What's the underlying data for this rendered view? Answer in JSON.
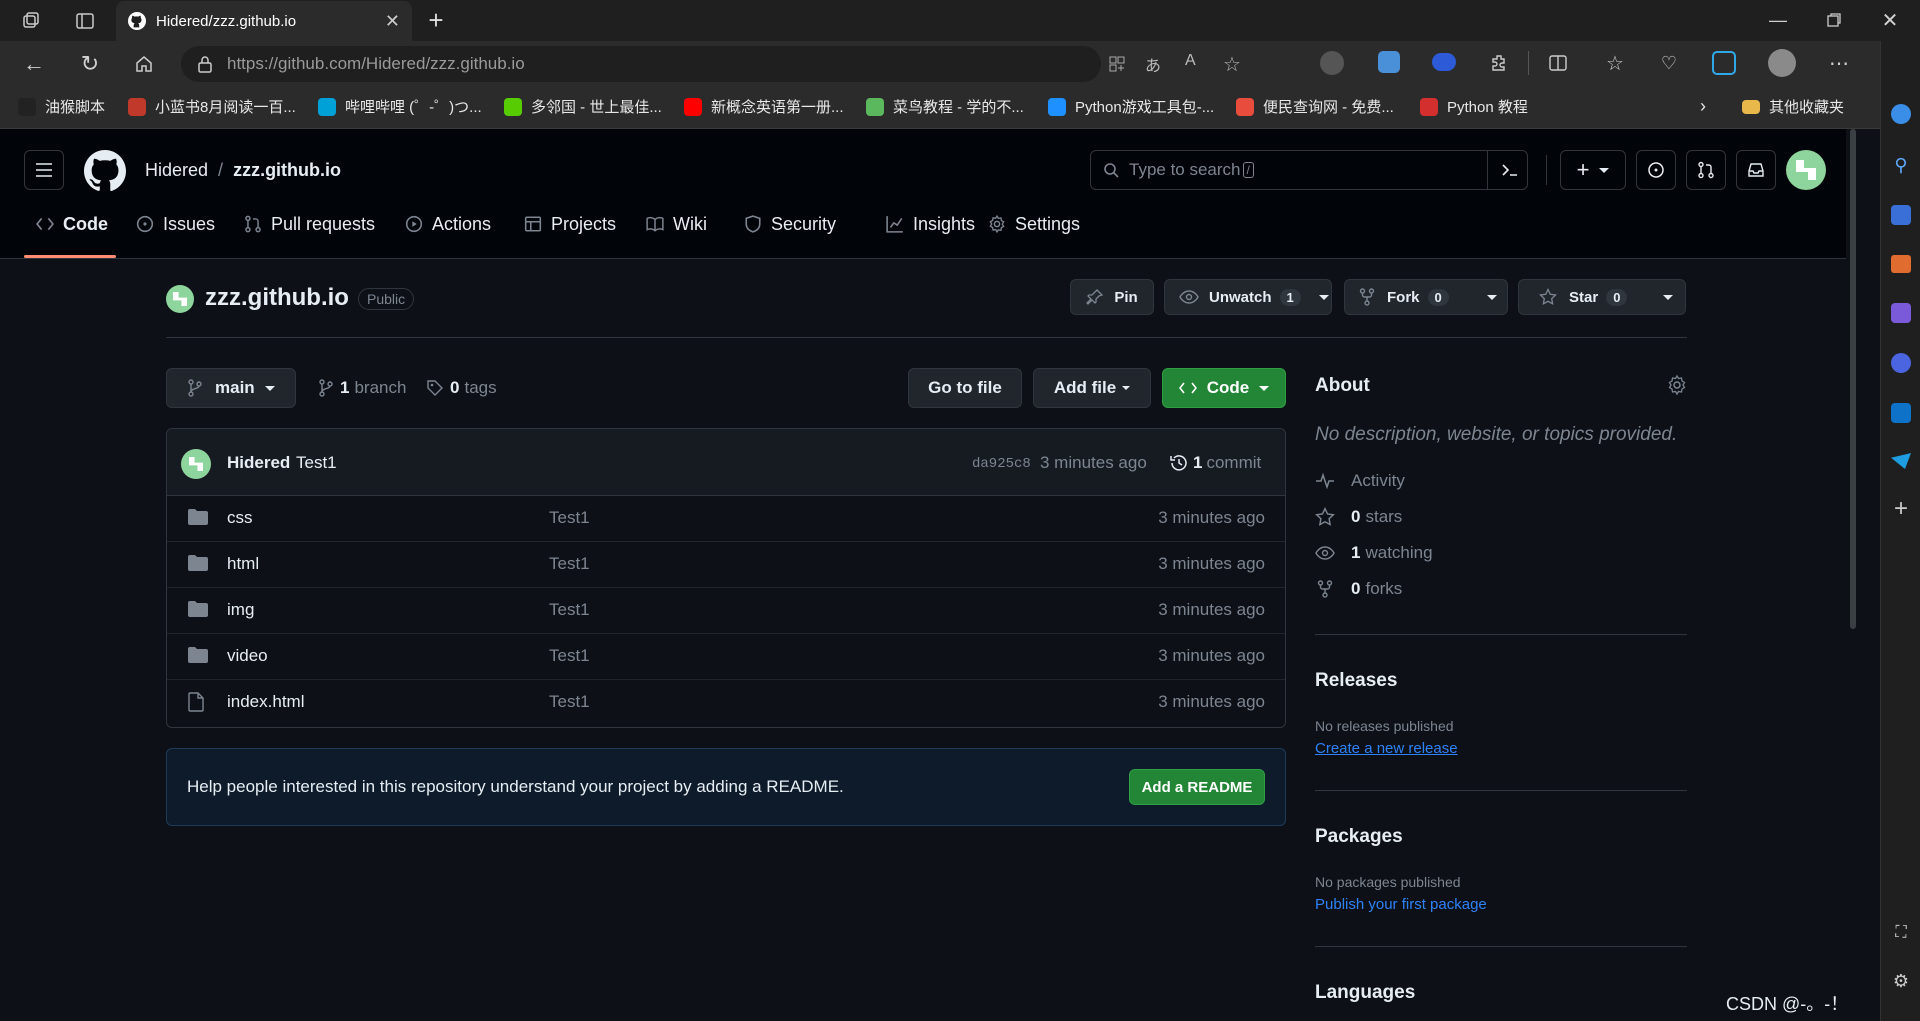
{
  "browser": {
    "tab_title": "Hidered/zzz.github.io",
    "url_host": "https://github.com",
    "url_path": "/Hidered/zzz.github.io",
    "bookmarks": [
      {
        "label": "油猴脚本",
        "color": "#222222"
      },
      {
        "label": "小蓝书8月阅读一百...",
        "color": "#c0392b"
      },
      {
        "label": "哔哩哔哩 (゜-゜)つ...",
        "color": "#00a1d6"
      },
      {
        "label": "多邻国 - 世上最佳...",
        "color": "#58cc02"
      },
      {
        "label": "新概念英语第一册...",
        "color": "#ff0000"
      },
      {
        "label": "菜鸟教程 - 学的不...",
        "color": "#5cb85c"
      },
      {
        "label": "Python游戏工具包-...",
        "color": "#1e90ff"
      },
      {
        "label": "便民查询网 - 免费...",
        "color": "#e74c3c"
      },
      {
        "label": "Python 教程",
        "color": "#d32f2f"
      }
    ],
    "other_bookmarks": "其他收藏夹"
  },
  "header": {
    "owner": "Hidered",
    "separator": "/",
    "repo": "zzz.github.io",
    "search_placeholder": "Type to search",
    "search_key": "/"
  },
  "nav": {
    "tabs": [
      {
        "label": "Code",
        "icon": "code-icon"
      },
      {
        "label": "Issues",
        "icon": "issue-icon"
      },
      {
        "label": "Pull requests",
        "icon": "pull-request-icon"
      },
      {
        "label": "Actions",
        "icon": "play-icon"
      },
      {
        "label": "Projects",
        "icon": "table-icon"
      },
      {
        "label": "Wiki",
        "icon": "book-icon"
      },
      {
        "label": "Security",
        "icon": "shield-icon"
      },
      {
        "label": "Insights",
        "icon": "graph-icon"
      },
      {
        "label": "Settings",
        "icon": "gear-icon"
      }
    ],
    "accent": "#fd8c73"
  },
  "repo": {
    "name": "zzz.github.io",
    "visibility": "Public",
    "pin": "Pin",
    "unwatch": "Unwatch",
    "unwatch_count": "1",
    "fork": "Fork",
    "fork_count": "0",
    "star": "Star",
    "star_count": "0"
  },
  "toolbar": {
    "branch": "main",
    "branch_count": "1",
    "branch_label": "branch",
    "tag_count": "0",
    "tag_label": "tags",
    "go_to_file": "Go to file",
    "add_file": "Add file",
    "code": "Code",
    "code_color": "#238636"
  },
  "commit": {
    "author": "Hidered",
    "message": "Test1",
    "sha": "da925c8",
    "time": "3 minutes ago",
    "count": "1",
    "count_label": "commit"
  },
  "files": [
    {
      "name": "css",
      "type": "folder",
      "message": "Test1",
      "age": "3 minutes ago"
    },
    {
      "name": "html",
      "type": "folder",
      "message": "Test1",
      "age": "3 minutes ago"
    },
    {
      "name": "img",
      "type": "folder",
      "message": "Test1",
      "age": "3 minutes ago"
    },
    {
      "name": "video",
      "type": "folder",
      "message": "Test1",
      "age": "3 minutes ago"
    },
    {
      "name": "index.html",
      "type": "file",
      "message": "Test1",
      "age": "3 minutes ago"
    }
  ],
  "readme_banner": {
    "text": "Help people interested in this repository understand your project by adding a README.",
    "button": "Add a README"
  },
  "about": {
    "title": "About",
    "description": "No description, website, or topics provided.",
    "activity": "Activity",
    "stars_count": "0",
    "stars_label": "stars",
    "watching_count": "1",
    "watching_label": "watching",
    "forks_count": "0",
    "forks_label": "forks"
  },
  "releases": {
    "title": "Releases",
    "empty": "No releases published",
    "link": "Create a new release"
  },
  "packages": {
    "title": "Packages",
    "empty": "No packages published",
    "link": "Publish your first package"
  },
  "languages": {
    "title": "Languages"
  },
  "watermark": "CSDN @-。-！！"
}
